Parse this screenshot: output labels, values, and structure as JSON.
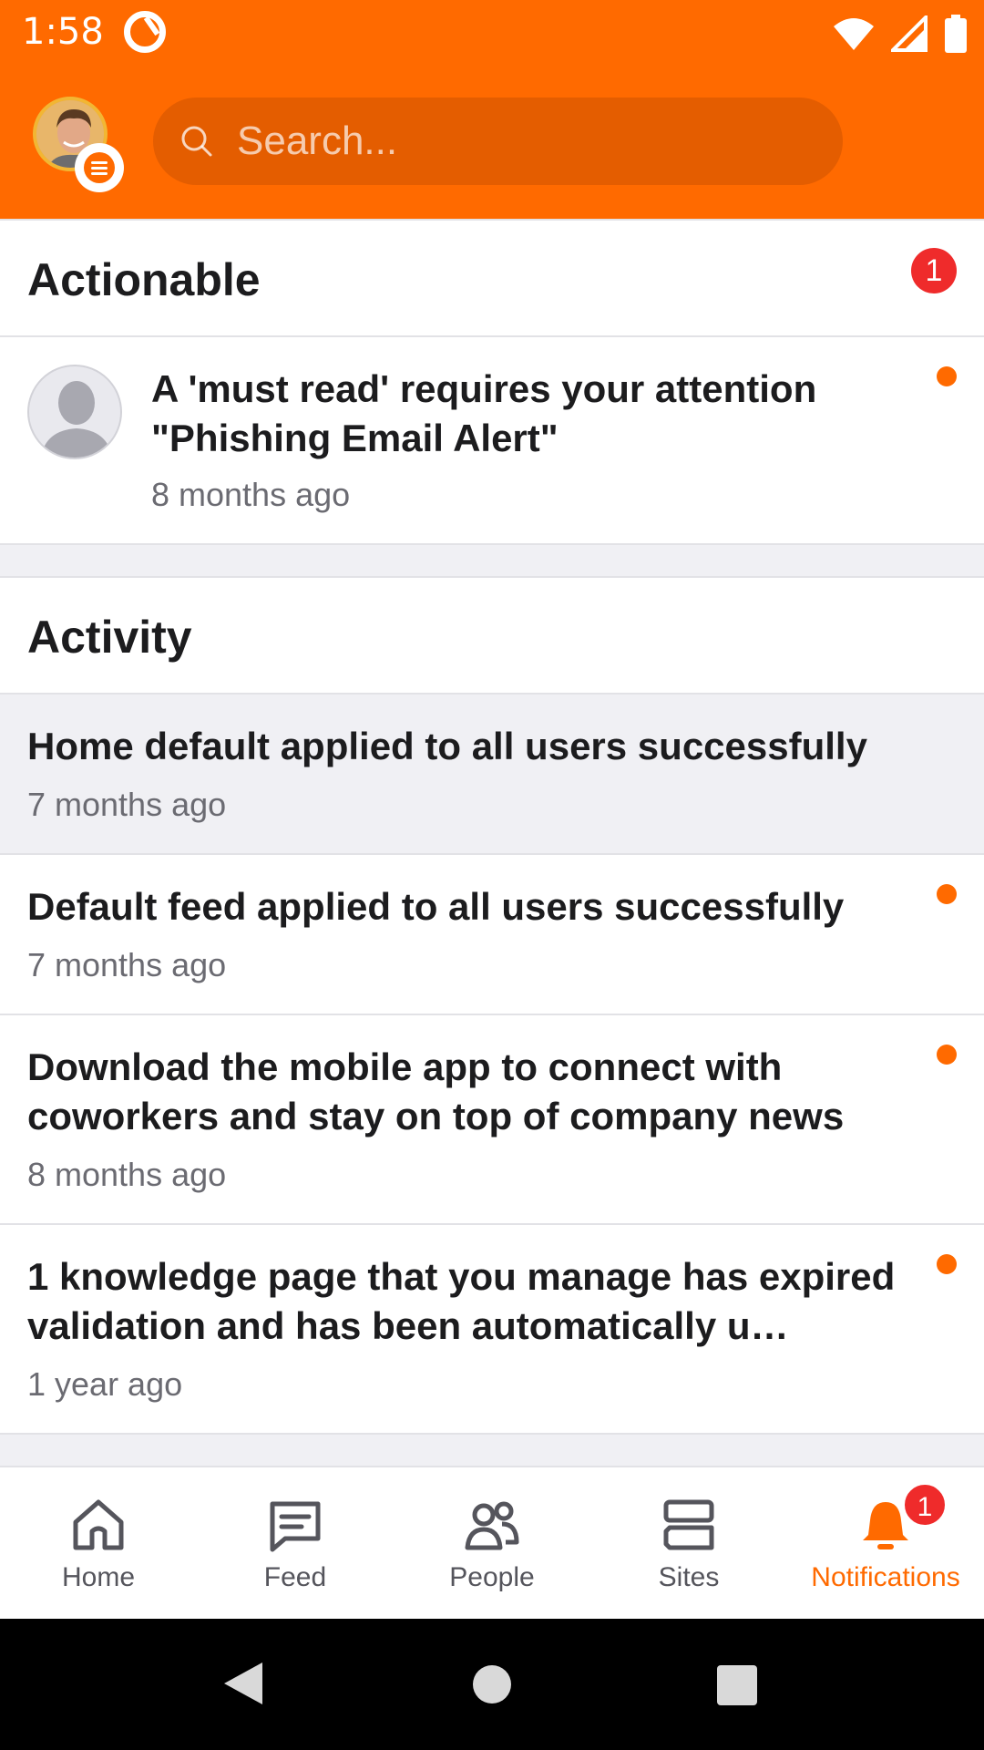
{
  "status_bar": {
    "time": "1:58"
  },
  "header": {
    "search_placeholder": "Search..."
  },
  "actionable": {
    "title": "Actionable",
    "count": "1",
    "items": [
      {
        "text": "A 'must read' requires your attention \"Phishing Email Alert\"",
        "time": "8 months ago",
        "unread": true
      }
    ]
  },
  "activity": {
    "title": "Activity",
    "items": [
      {
        "text": "Home default applied to all users successfully",
        "time": "7 months ago",
        "unread": false
      },
      {
        "text": "Default feed applied to all users successfully",
        "time": "7 months ago",
        "unread": true
      },
      {
        "text": "Download the mobile app to connect with coworkers and stay on top of company news",
        "time": "8 months ago",
        "unread": true
      },
      {
        "text": "1 knowledge page that you manage has expired validation and has been automatically u…",
        "time": "1 year ago",
        "unread": true
      }
    ]
  },
  "bottom_nav": {
    "items": [
      {
        "label": "Home",
        "icon": "home-icon"
      },
      {
        "label": "Feed",
        "icon": "feed-icon"
      },
      {
        "label": "People",
        "icon": "people-icon"
      },
      {
        "label": "Sites",
        "icon": "sites-icon"
      },
      {
        "label": "Notifications",
        "icon": "bell-icon",
        "active": true,
        "badge": "1"
      }
    ]
  },
  "colors": {
    "brand": "#ff6a00",
    "badge": "#ef2b2b",
    "highlight_row": "#f0f0f4"
  }
}
